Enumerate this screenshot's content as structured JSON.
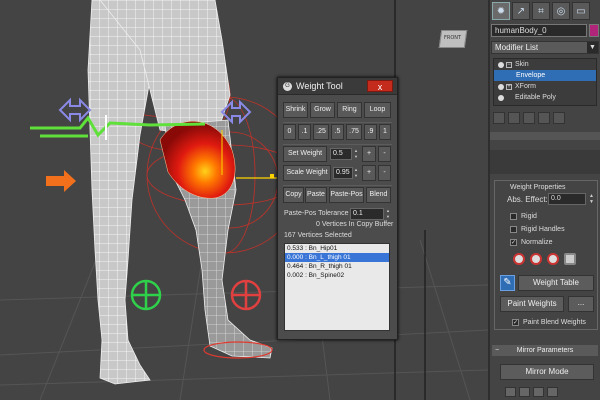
{
  "viewport": {
    "viewcube_label": "FRONT"
  },
  "command_panel": {
    "tabs": [
      {
        "icon": "sun-icon",
        "glyph": "✹"
      },
      {
        "icon": "curve-editor-icon",
        "glyph": "↗"
      },
      {
        "icon": "hierarchy-icon",
        "glyph": "⌗"
      },
      {
        "icon": "motion-icon",
        "glyph": "◎"
      },
      {
        "icon": "display-icon",
        "glyph": "▭"
      },
      {
        "icon": "utilities-icon",
        "glyph": "⚒"
      }
    ],
    "object_name": "humanBody_0",
    "object_color": "#b0247a",
    "modifier_list": "Modifier List",
    "stack": [
      {
        "label": "Skin",
        "toggle": "−",
        "selected": false,
        "indent": 0
      },
      {
        "label": "Envelope",
        "toggle": "",
        "selected": true,
        "indent": 1
      },
      {
        "label": "XForm",
        "toggle": "+",
        "selected": false,
        "indent": 0
      },
      {
        "label": "Editable Poly",
        "toggle": "",
        "selected": false,
        "indent": 0
      }
    ],
    "weight_properties": {
      "title": "Weight Properties",
      "abs_effect_label": "Abs. Effect:",
      "abs_effect_value": "0.0",
      "rigid_label": "Rigid",
      "rigid_handles_label": "Rigid Handles",
      "normalize_label": "Normalize",
      "normalize_checked": true
    },
    "weight_table_button": "Weight Table",
    "paint_weights_button": "Paint Weights",
    "paint_weights_more": "...",
    "paint_blend_label": "Paint Blend Weights",
    "paint_blend_checked": true,
    "mirror_params_title": "Mirror Parameters",
    "mirror_params_toggle": "−",
    "mirror_mode_button": "Mirror Mode"
  },
  "weight_tool": {
    "title": "Weight Tool",
    "close_label": "x",
    "shrink": "Shrink",
    "grow": "Grow",
    "ring": "Ring",
    "loop": "Loop",
    "presets": [
      "0",
      ".1",
      ".25",
      ".5",
      ".75",
      ".9",
      "1"
    ],
    "set_weight_label": "Set Weight",
    "set_weight_value": "0.5",
    "scale_weight_label": "Scale Weight",
    "scale_weight_value": "0.95",
    "plus": "+",
    "minus": "-",
    "copy": "Copy",
    "paste": "Paste",
    "paste_pos": "Paste-Pos",
    "blend": "Blend",
    "tolerance_label": "Paste-Pos Tolerance",
    "tolerance_value": "0.1",
    "copy_buffer": "0 Vertices In Copy Buffer",
    "vertices_selected": "167 Vertices Selected",
    "bone_weights": [
      {
        "text": "0.533 : Bn_Hip01",
        "selected": false
      },
      {
        "text": "0.000 : Bn_L_thigh 01",
        "selected": true
      },
      {
        "text": "0.464 : Bn_R_thigh 01",
        "selected": false
      },
      {
        "text": "0.002 : Bn_Spine02",
        "selected": false
      }
    ]
  }
}
